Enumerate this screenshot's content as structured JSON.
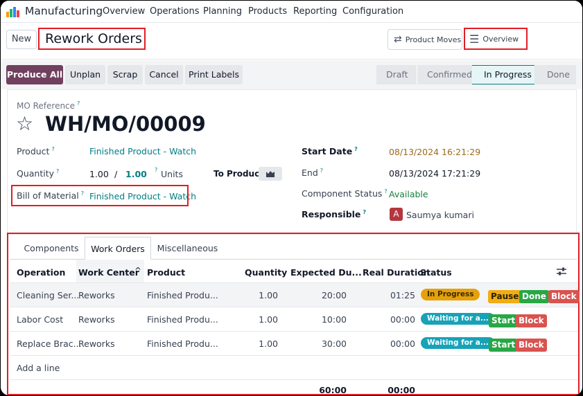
{
  "navbar": {
    "app_title": "Manufacturing",
    "menu": [
      "Overview",
      "Operations",
      "Planning",
      "Products",
      "Reporting",
      "Configuration"
    ]
  },
  "control_panel": {
    "new_label": "New",
    "title": "Rework Orders",
    "product_moves_label": "Product Moves",
    "overview_label": "Overview"
  },
  "actions": {
    "buttons": [
      "Produce All",
      "Unplan",
      "Scrap",
      "Cancel",
      "Print Labels"
    ],
    "stages": [
      "Draft",
      "Confirmed",
      "In Progress",
      "Done"
    ],
    "active_stage": "In Progress"
  },
  "form": {
    "mo_reference_label": "MO Reference",
    "mo_reference": "WH/MO/00009",
    "product_label": "Product",
    "product": "Finished Product - Watch",
    "quantity_label": "Quantity",
    "quantity": "1.00",
    "quantity_sep": "/",
    "quantity_target": "1.00",
    "quantity_unit": "Units",
    "to_produce_label": "To Produce",
    "bom_label": "Bill of Material",
    "bom": "Finished Product - Watch",
    "start_date_label": "Start Date",
    "start_date": "08/13/2024 16:21:29",
    "end_label": "End",
    "end": "08/13/2024 17:21:29",
    "component_status_label": "Component Status",
    "component_status": "Available",
    "responsible_label": "Responsible",
    "responsible_initial": "A",
    "responsible": "Saumya kumari"
  },
  "tabs": [
    "Components",
    "Work Orders",
    "Miscellaneous"
  ],
  "active_tab": "Work Orders",
  "table": {
    "headers": [
      "Operation",
      "Work Center",
      "Product",
      "Quantity",
      "Expected Du...",
      "Real Duration",
      "Status"
    ],
    "rows": [
      {
        "operation": "Cleaning Ser...",
        "work_center": "Reworks",
        "product": "Finished Produ...",
        "quantity": "1.00",
        "expected": "20:00",
        "real": "01:25",
        "status": "In Progress",
        "buttons": [
          "Pause",
          "Done",
          "Block"
        ]
      },
      {
        "operation": "Labor Cost",
        "work_center": "Reworks",
        "product": "Finished Produ...",
        "quantity": "1.00",
        "expected": "10:00",
        "real": "00:00",
        "status": "Waiting for a...",
        "buttons": [
          "Start",
          "Block"
        ]
      },
      {
        "operation": "Replace Brac...",
        "work_center": "Reworks",
        "product": "Finished Produ...",
        "quantity": "1.00",
        "expected": "30:00",
        "real": "00:00",
        "status": "Waiting for a...",
        "buttons": [
          "Start",
          "Block"
        ]
      }
    ],
    "add_line_label": "Add a line",
    "total_expected": "60:00",
    "total_real": "00:00"
  },
  "colors": {
    "primary": "#71405f",
    "link": "#017e84",
    "highlight": "#e11d24",
    "in_progress": "#e6a10a",
    "waiting": "#17a2b8",
    "btn_green": "#28a745",
    "btn_red": "#d9534f",
    "btn_yellow": "#f0ad16"
  }
}
